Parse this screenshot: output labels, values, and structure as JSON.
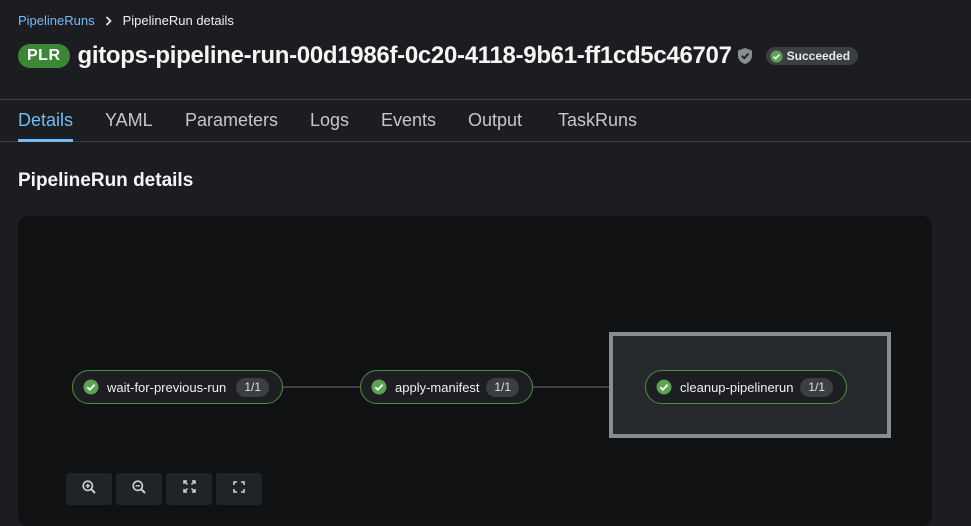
{
  "breadcrumb": {
    "parent_label": "PipelineRuns",
    "current_label": "PipelineRun details"
  },
  "header": {
    "resource_badge": "PLR",
    "title": "gitops-pipeline-run-00d1986f-0c20-4118-9b61-ff1cd5c46707",
    "status": "Succeeded"
  },
  "tabs": [
    {
      "label": "Details",
      "active": true
    },
    {
      "label": "YAML"
    },
    {
      "label": "Parameters"
    },
    {
      "label": "Logs"
    },
    {
      "label": "Events"
    },
    {
      "label": "Output"
    },
    {
      "label": "TaskRuns"
    }
  ],
  "section": {
    "title": "PipelineRun details"
  },
  "pipeline": {
    "tasks": [
      {
        "name": "wait-for-previous-run",
        "count": "1/1",
        "status": "succeeded"
      },
      {
        "name": "apply-manifest",
        "count": "1/1",
        "status": "succeeded"
      },
      {
        "name": "cleanup-pipelinerun",
        "count": "1/1",
        "status": "succeeded",
        "selected": true
      }
    ]
  },
  "zoom_controls": [
    {
      "icon": "zoom-in-icon"
    },
    {
      "icon": "zoom-out-icon"
    },
    {
      "icon": "fit-to-screen-icon"
    },
    {
      "icon": "reset-view-icon"
    }
  ],
  "colors": {
    "link": "#73bcf7",
    "success": "#3e8635",
    "background": "#1b1d21"
  }
}
